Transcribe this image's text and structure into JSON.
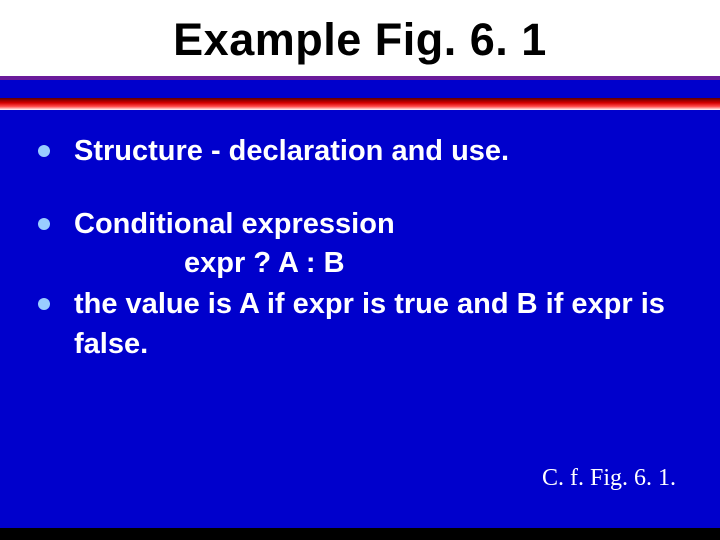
{
  "title": "Example Fig. 6. 1",
  "bullets": {
    "b1": "Structure - declaration and use.",
    "b2_line1": "Conditional expression",
    "b2_line2": "expr ? A : B",
    "b3": "the value is A if expr is true and B if expr is false."
  },
  "footnote": "C. f. Fig. 6. 1."
}
